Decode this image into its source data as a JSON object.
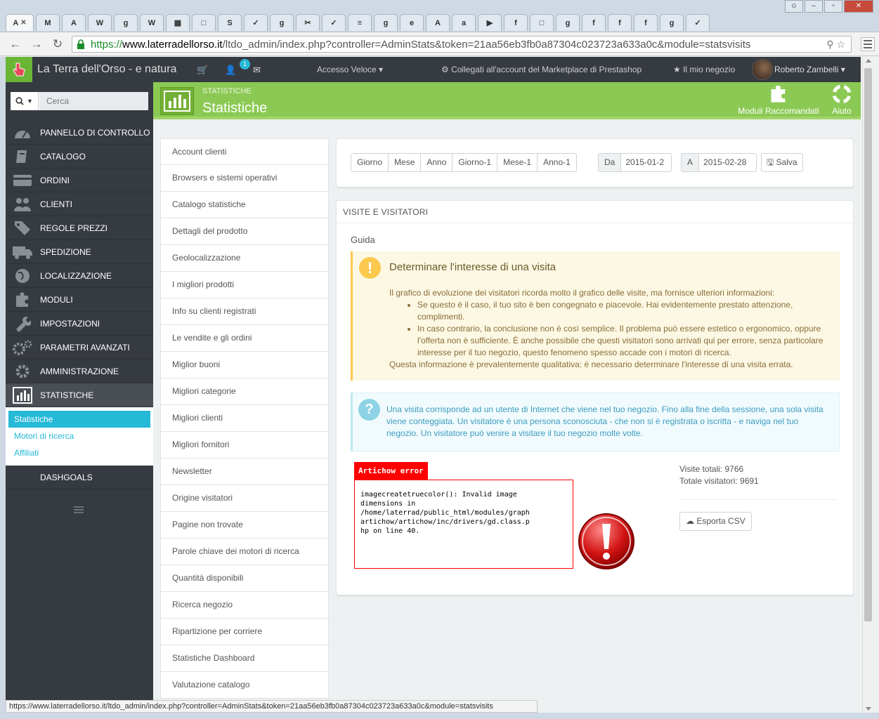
{
  "browser": {
    "tab_icons": [
      "A",
      "M",
      "A",
      "W",
      "g",
      "W",
      "▦",
      "□",
      "S",
      "✓",
      "g",
      "✂",
      "✓",
      "≡",
      "g",
      "e",
      "A",
      "a",
      "▶",
      "f",
      "□",
      "g",
      "f",
      "f",
      "f",
      "g",
      "✓"
    ],
    "url_scheme": "https://",
    "url_host": "www.laterradellorso.it",
    "url_path": "/ltdo_admin/index.php?controller=AdminStats&token=21aa56eb3fb0a87304c023723a633a0c&module=statsvisits",
    "status_url": "https://www.laterradellorso.it/ltdo_admin/index.php?controller=AdminStats&token=21aa56eb3fb0a87304c023723a633a0c&module=statsvisits"
  },
  "header": {
    "shop_name": "La Terra dell'Orso - e natura",
    "badge_count": "1",
    "quick_access": "Accesso Veloce",
    "marketplace": "Collegati all'account del Marketplace di Prestashop",
    "my_shop": "Il mio negozio",
    "user": "Roberto Zambelli"
  },
  "sidebar": {
    "search_placeholder": "Cerca",
    "items": [
      {
        "label": "PANNELLO DI CONTROLLO"
      },
      {
        "label": "CATALOGO"
      },
      {
        "label": "ORDINI"
      },
      {
        "label": "CLIENTI"
      },
      {
        "label": "REGOLE PREZZI"
      },
      {
        "label": "SPEDIZIONE"
      },
      {
        "label": "LOCALIZZAZIONE"
      },
      {
        "label": "MODULI"
      },
      {
        "label": "IMPOSTAZIONI"
      },
      {
        "label": "PARAMETRI AVANZATI"
      },
      {
        "label": "AMMINISTRAZIONE"
      },
      {
        "label": "STATISTICHE"
      }
    ],
    "sub_items": [
      "Statistiche",
      "Motori di ricerca",
      "Affiliati"
    ],
    "dashgoals": "DASHGOALS"
  },
  "page_head": {
    "breadcrumb": "STATISTICHE",
    "title": "Statistiche",
    "btn_modules": "Moduli Raccomandati",
    "btn_help": "Aiuto"
  },
  "reports": [
    "Account clienti",
    "Browsers e sistemi operativi",
    "Catalogo statistiche",
    "Dettagli del prodotto",
    "Geolocalizzazione",
    "I migliori prodotti",
    "Info su clienti registrati",
    "Le vendite e gli ordini",
    "Miglior buoni",
    "Migliori categorie",
    "Migliori clienti",
    "Migliori fornitori",
    "Newsletter",
    "Origine visitatori",
    "Pagine non trovate",
    "Parole chiave dei motori di ricerca",
    "Quantità disponibili",
    "Ricerca negozio",
    "Ripartizione per corriere",
    "Statistiche Dashboard",
    "Valutazione catalogo"
  ],
  "period_buttons": [
    "Giorno",
    "Mese",
    "Anno",
    "Giorno-1",
    "Mese-1",
    "Anno-1"
  ],
  "date_from_label": "Da",
  "date_from": "2015-01-2",
  "date_to_label": "A",
  "date_to": "2015-02-28",
  "save_label": "Salva",
  "panel": {
    "heading": "VISITE E VISITATORI",
    "guide": "Guida",
    "warn_title": "Determinare l'interesse di una visita",
    "warn_intro": "Il grafico di evoluzione dei visitatori ricorda molto il grafico delle visite, ma fornisce ulteriori informazioni:",
    "warn_li1": "Se questo è il caso, il tuo sito è ben congegnato e piacevole. Hai evidentemente prestato attenzione, complimenti.",
    "warn_li2": "In caso contrario, la conclusione non è così semplice. Il problema può essere estetico o ergonomico, oppure l'offerta non è sufficiente. È anche possibile che questi visitatori sono arrivati qui per errore, senza particolare interesse per il tuo negozio, questo fenomeno spesso accade con i motori di ricerca.",
    "warn_outro": "Questa informazione è prevalentemente qualitativa: è necessario determinare l'interesse di una visita errata.",
    "info_text": "Una visita corrisponde ad un utente di Internet che viene nel tuo negozio. Fino alla fine della sessione, una sola visita viene conteggiata. Un visitatore è una persona sconosciuta - che non si è registrata o iscritta - e naviga nel tuo negozio. Un visitatore può venire a visitare il tuo negozio molte volte.",
    "error_tag": "Artichow error",
    "error_text": "imagecreatetruecolor(): Invalid image\ndimensions in\n/home/laterrad/public_html/modules/graph\nartichow/artichow/inc/drivers/gd.class.p\nhp on line 40.",
    "total_visits": "Visite totali: 9766",
    "total_visitors": "Totale visitatori: 9691",
    "csv_label": "Esporta CSV"
  },
  "colors": {
    "accent_green": "#8bc954",
    "info_blue": "#25b9d7",
    "sidebar_dark": "#363a41",
    "error_red": "#ff0000"
  }
}
